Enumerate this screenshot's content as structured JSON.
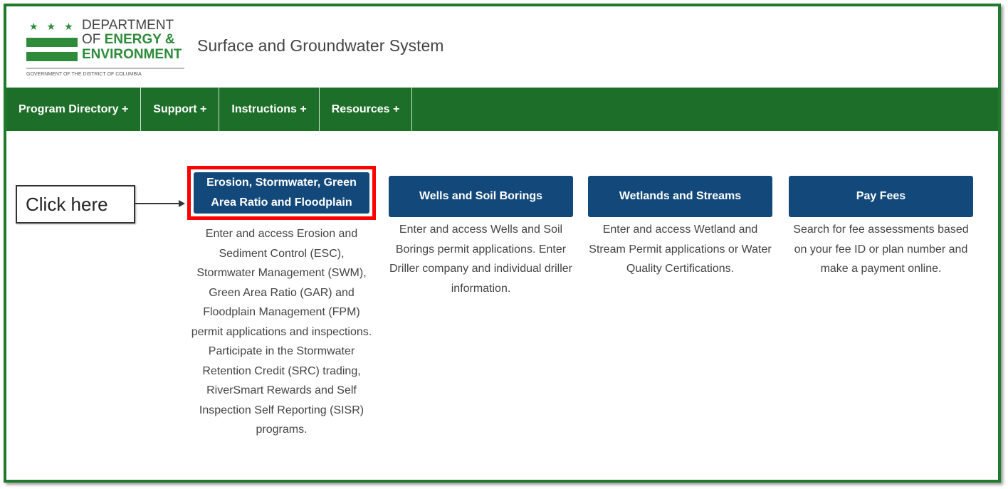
{
  "logo": {
    "line1": "DEPARTMENT",
    "line2_a": "OF ",
    "line2_b": "ENERGY &",
    "line3": "ENVIRONMENT",
    "gov": "GOVERNMENT OF THE DISTRICT OF COLUMBIA"
  },
  "header": {
    "title": "Surface and Groundwater System"
  },
  "nav": [
    "Program Directory +",
    "Support +",
    "Instructions +",
    "Resources +"
  ],
  "cards": [
    {
      "button": "Erosion, Stormwater, Green Area Ratio and Floodplain",
      "description": "Enter and access Erosion and Sediment Control (ESC), Stormwater Management (SWM), Green Area Ratio (GAR) and Floodplain Management (FPM) permit applications and inspections. Participate in the Stormwater Retention Credit (SRC) trading, RiverSmart Rewards and Self Inspection Self Reporting (SISR) programs."
    },
    {
      "button": "Wells and Soil Borings",
      "description": "Enter and access Wells and Soil Borings permit applications. Enter Driller company and individual driller information."
    },
    {
      "button": "Wetlands and Streams",
      "description": "Enter and access Wetland and Stream Permit applications or Water Quality Certifications."
    },
    {
      "button": "Pay Fees",
      "description": "Search for fee assessments based on your fee ID or plan number and make a payment online."
    }
  ],
  "annotation": {
    "label": "Click here",
    "highlight_color": "#ff0000"
  },
  "colors": {
    "brand_green": "#1d6e28",
    "button_navy": "#13497a"
  }
}
